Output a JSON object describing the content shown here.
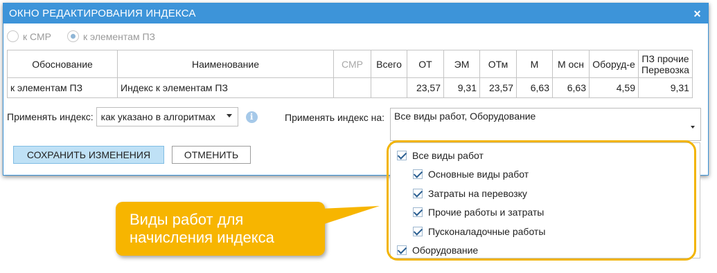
{
  "window": {
    "title": "ОКНО РЕДАКТИРОВАНИЯ ИНДЕКСА",
    "close_glyph": "×"
  },
  "radio": [
    {
      "label": "к СМР",
      "checked": false
    },
    {
      "label": "к элементам ПЗ",
      "checked": true
    }
  ],
  "table": {
    "headers": [
      "Обоснование",
      "Наименование",
      "СМР",
      "Всего",
      "ОТ",
      "ЭМ",
      "ОТм",
      "М",
      "М осн",
      "Оборуд-е",
      "ПЗ прочие",
      "Перевозка"
    ],
    "row": [
      "к элементам ПЗ",
      "Индекс к элементам ПЗ",
      "",
      "",
      "23,57",
      "9,31",
      "23,57",
      "6,63",
      "6,63",
      "4,59",
      "9,31"
    ]
  },
  "apply": {
    "label": "Применять индекс:",
    "select_value": "как указано в алгоритмах",
    "info_glyph": "i",
    "on_label": "Применять индекс на:",
    "on_value": "Все виды работ, Оборудование"
  },
  "buttons": {
    "save": "СОХРАНИТЬ ИЗМЕНЕНИЯ",
    "cancel": "ОТМЕНИТЬ"
  },
  "dropdown": {
    "items": [
      {
        "label": "Все виды работ",
        "checked": true
      },
      {
        "label": "Основные виды работ",
        "checked": true
      },
      {
        "label": "Затраты на перевозку",
        "checked": true
      },
      {
        "label": "Прочие работы и затраты",
        "checked": true
      },
      {
        "label": "Пусконаладочные работы",
        "checked": true
      },
      {
        "label": "Оборудование",
        "checked": true
      }
    ]
  },
  "callout": {
    "line1": "Виды работ для",
    "line2": "начисления индекса"
  },
  "colors": {
    "title_bar": "#3d94d9",
    "accent": "#f2b400",
    "save_button": "#bfe1f6"
  }
}
